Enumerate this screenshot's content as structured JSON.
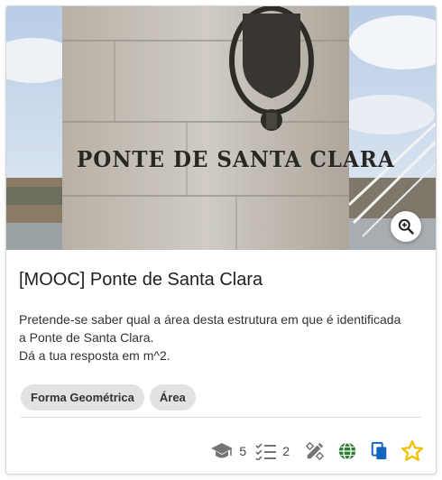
{
  "image": {
    "monument_inscription": "PONTE DE SANTA CLARA",
    "zoom_icon": "zoom-in-icon"
  },
  "card": {
    "title": "[MOOC] Ponte de Santa Clara",
    "description_lines": [
      "Pretende-se saber qual a área desta estrutura em que é identificada",
      "a Ponte de Santa Clara.",
      "Dá a tua resposta em m^2."
    ],
    "tags": [
      "Forma Geométrica",
      "Área"
    ]
  },
  "footer": {
    "students_count": "5",
    "tasks_count": "2",
    "icons": [
      "graduation-cap-icon",
      "checklist-icon",
      "edit-ruler-icon",
      "globe-icon",
      "copy-icon",
      "star-icon"
    ],
    "colors": {
      "globe": "#2e7d32",
      "copy": "#1565c0",
      "star": "#f2c200",
      "muted": "#757575"
    }
  }
}
